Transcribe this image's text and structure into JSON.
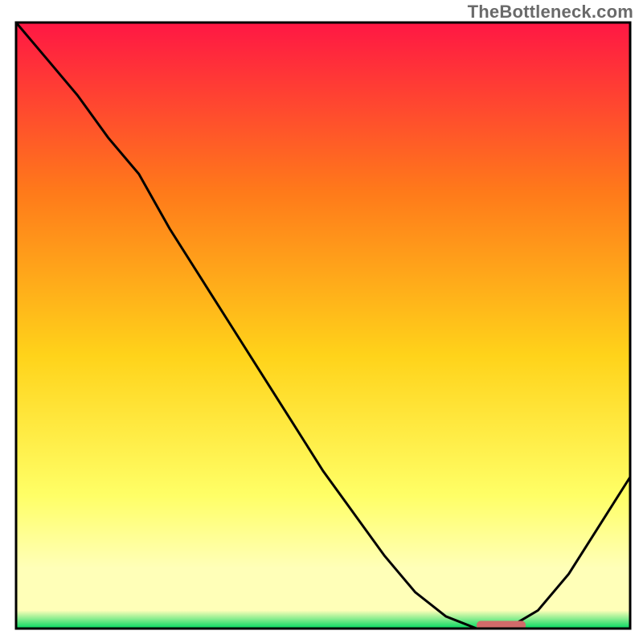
{
  "watermark": "TheBottleneck.com",
  "colors": {
    "top": "#ff1744",
    "orange": "#ff7a1a",
    "yellow_mid": "#ffd31a",
    "yellow_light": "#ffff66",
    "pale_yellow": "#ffffb8",
    "green": "#00d860",
    "curve": "#000000",
    "frame": "#000000",
    "marker": "#d16a6a"
  },
  "chart_data": {
    "type": "line",
    "title": "",
    "xlabel": "",
    "ylabel": "",
    "xlim": [
      0,
      100
    ],
    "ylim": [
      0,
      100
    ],
    "x": [
      0,
      5,
      10,
      15,
      20,
      25,
      30,
      35,
      40,
      45,
      50,
      55,
      60,
      65,
      70,
      75,
      80,
      85,
      90,
      95,
      100
    ],
    "values": [
      100,
      94,
      88,
      81,
      75,
      66,
      58,
      50,
      42,
      34,
      26,
      19,
      12,
      6,
      2,
      0,
      0,
      3,
      9,
      17,
      25
    ],
    "optimum_marker": {
      "x_start": 75,
      "x_end": 83,
      "y": 0.6
    },
    "note": "Background is a vertical gradient red→green indicating bottleneck severity; curve dips to 0 at the optimum band marked by the pink segment near x≈75–83."
  }
}
